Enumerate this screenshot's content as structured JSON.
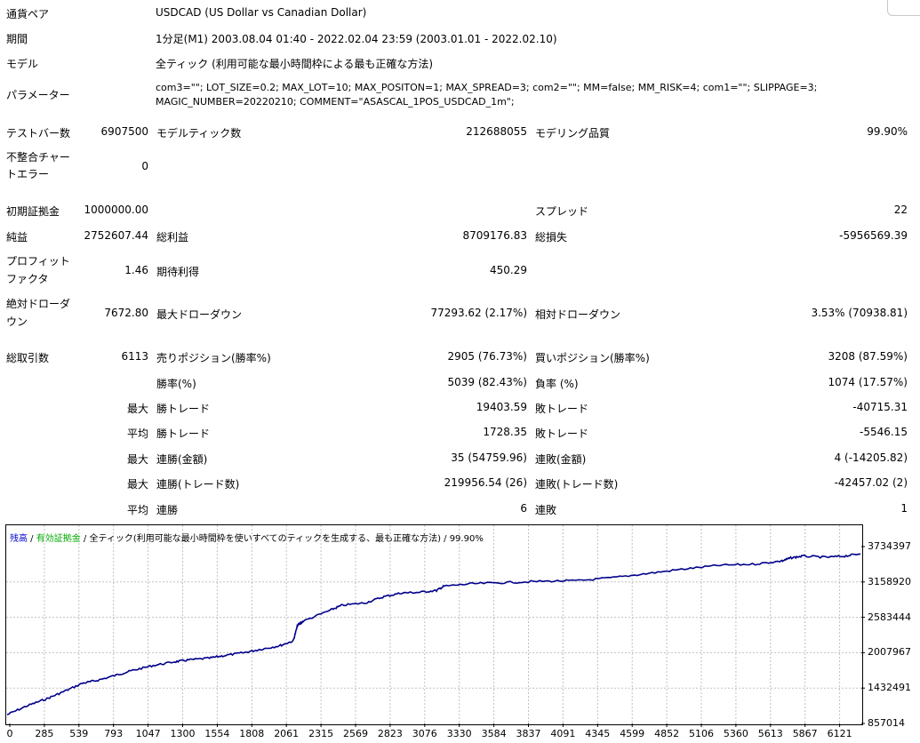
{
  "info": {
    "pair_label": "通貨ペア",
    "pair_value": "USDCAD (US Dollar vs Canadian Dollar)",
    "period_label": "期間",
    "period_value": "1分足(M1) 2003.08.04 01:40 - 2022.02.04 23:59 (2003.01.01 - 2022.02.10)",
    "model_label": "モデル",
    "model_value": "全ティック (利用可能な最小時間枠による最も正確な方法)",
    "params_label": "パラメーター",
    "params_line1": "com3=\"\"; LOT_SIZE=0.2; MAX_LOT=10; MAX_POSITON=1; MAX_SPREAD=3; com2=\"\"; MM=false; MM_RISK=4; com1=\"\"; SLIPPAGE=3;",
    "params_line2": "MAGIC_NUMBER=20220210; COMMENT=\"ASASCAL_1POS_USDCAD_1m\";"
  },
  "stats": {
    "test_bars_label": "テストバー数",
    "test_bars_value": "6907500",
    "model_ticks_label": "モデルティック数",
    "model_ticks_value": "212688055",
    "model_quality_label": "モデリング品質",
    "model_quality_value": "99.90%",
    "mismatch_label_1": "不整合チャー",
    "mismatch_label_2": "トエラー",
    "mismatch_value": "0",
    "initial_deposit_label": "初期証拠金",
    "initial_deposit_value": "1000000.00",
    "spread_label": "スプレッド",
    "spread_value": "22",
    "net_profit_label": "純益",
    "net_profit_value": "2752607.44",
    "gross_profit_label": "総利益",
    "gross_profit_value": "8709176.83",
    "gross_loss_label": "総損失",
    "gross_loss_value": "-5956569.39",
    "profit_factor_label_1": "プロフィット",
    "profit_factor_label_2": "ファクタ",
    "profit_factor_value": "1.46",
    "expected_payoff_label": "期待利得",
    "expected_payoff_value": "450.29",
    "abs_dd_label_1": "絶対ドローダ",
    "abs_dd_label_2": "ウン",
    "abs_dd_value": "7672.80",
    "max_dd_label": "最大ドローダウン",
    "max_dd_value": "77293.62 (2.17%)",
    "rel_dd_label": "相対ドローダウン",
    "rel_dd_value": "3.53% (70938.81)",
    "total_trades_label": "総取引数",
    "total_trades_value": "6113",
    "short_label": "売りポジション(勝率%)",
    "short_value": "2905 (76.73%)",
    "long_label": "買いポジション(勝率%)",
    "long_value": "3208 (87.59%)",
    "win_rate_label": "勝率(%)",
    "win_rate_value": "5039 (82.43%)",
    "loss_rate_label": "負率 (%)",
    "loss_rate_value": "1074 (17.57%)",
    "max_label": "最大",
    "avg_label": "平均",
    "largest_win_label": "勝トレード",
    "largest_win_value": "19403.59",
    "largest_loss_label": "敗トレード",
    "largest_loss_value": "-40715.31",
    "avg_win_label": "勝トレード",
    "avg_win_value": "1728.35",
    "avg_loss_label": "敗トレード",
    "avg_loss_value": "-5546.15",
    "max_consec_wins_amt_label": "連勝(金額)",
    "max_consec_wins_amt_value": "35 (54759.96)",
    "max_consec_losses_amt_label": "連敗(金額)",
    "max_consec_losses_amt_value": "4 (-14205.82)",
    "max_consec_wins_cnt_label": "連勝(トレード数)",
    "max_consec_wins_cnt_value": "219956.54 (26)",
    "max_consec_losses_cnt_label": "連敗(トレード数)",
    "max_consec_losses_cnt_value": "-42457.02 (2)",
    "avg_consec_wins_label": "連勝",
    "avg_consec_wins_value": "6",
    "avg_consec_losses_label": "連敗",
    "avg_consec_losses_value": "1"
  },
  "chart_header": {
    "balance": "残高",
    "sep1": " / ",
    "equity": "有効証拠金",
    "sep2": " / ",
    "rest": "全ティック(利用可能な最小時間枠を使いすべてのティックを生成する、最も正確な方法) / 99.90%",
    "balance_color": "#0000cc",
    "equity_color": "#00aa00"
  },
  "chart_data": {
    "type": "line",
    "x_ticks": [
      "0",
      "285",
      "539",
      "793",
      "1047",
      "1300",
      "1554",
      "1808",
      "2061",
      "2315",
      "2569",
      "2823",
      "3076",
      "3330",
      "3584",
      "3837",
      "4091",
      "4345",
      "4599",
      "4852",
      "5106",
      "5360",
      "5613",
      "5867",
      "6121"
    ],
    "y_ticks": [
      "3734397",
      "3158920",
      "2583444",
      "2007967",
      "1432491",
      "857014"
    ],
    "ylim": [
      857014,
      3734397
    ],
    "xlim": [
      0,
      6113
    ],
    "series": [
      {
        "color": "#00008b",
        "x": [
          0,
          150,
          285,
          400,
          539,
          650,
          793,
          900,
          1047,
          1200,
          1300,
          1450,
          1554,
          1700,
          1808,
          1950,
          2050,
          2080,
          2120,
          2315,
          2400,
          2569,
          2700,
          2823,
          2950,
          3076,
          3130,
          3330,
          3584,
          3837,
          4091,
          4345,
          4599,
          4852,
          5106,
          5360,
          5550,
          5613,
          5700,
          5867,
          6000,
          6113
        ],
        "y": [
          1000000,
          1150000,
          1260000,
          1370000,
          1510000,
          1560000,
          1650000,
          1720000,
          1800000,
          1860000,
          1890000,
          1920000,
          1960000,
          2010000,
          2060000,
          2120000,
          2200000,
          2450000,
          2520000,
          2700000,
          2780000,
          2820000,
          2920000,
          2980000,
          2990000,
          3020000,
          3090000,
          3130000,
          3150000,
          3170000,
          3180000,
          3230000,
          3300000,
          3370000,
          3430000,
          3450000,
          3500000,
          3550000,
          3580000,
          3560000,
          3580000,
          3620000
        ]
      }
    ]
  }
}
